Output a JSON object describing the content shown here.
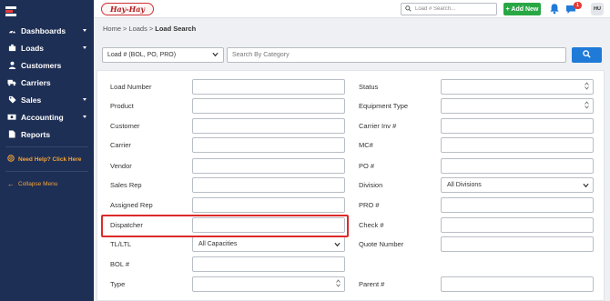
{
  "app": {
    "brand": "Hay-Hay"
  },
  "sidebar": {
    "items": [
      {
        "label": "Dashboards",
        "icon": "dashboard-icon",
        "has_caret": true
      },
      {
        "label": "Loads",
        "icon": "loads-icon",
        "has_caret": true
      },
      {
        "label": "Customers",
        "icon": "customers-icon",
        "has_caret": false
      },
      {
        "label": "Carriers",
        "icon": "truck-icon",
        "has_caret": false
      },
      {
        "label": "Sales",
        "icon": "sales-icon",
        "has_caret": true
      },
      {
        "label": "Accounting",
        "icon": "accounting-icon",
        "has_caret": true
      },
      {
        "label": "Reports",
        "icon": "reports-icon",
        "has_caret": false
      }
    ],
    "help_label": "Need Help? Click Here",
    "collapse_label": "Collapse Menu"
  },
  "topbar": {
    "search_placeholder": "Load # Search...",
    "add_new_label": "+ Add New",
    "message_badge": "1",
    "avatar_initials": "HU"
  },
  "breadcrumb": {
    "home": "Home",
    "sep1": ">",
    "loads": "Loads",
    "sep2": ">",
    "current": "Load Search"
  },
  "search": {
    "category_value": "Load # (BOL, PO, PRO)",
    "input_placeholder": "Search By Category"
  },
  "form": {
    "left": [
      {
        "label": "Load Number",
        "value": "",
        "kind": "text"
      },
      {
        "label": "Product",
        "value": "",
        "kind": "text"
      },
      {
        "label": "Customer",
        "value": "",
        "kind": "text"
      },
      {
        "label": "Carrier",
        "value": "",
        "kind": "text"
      },
      {
        "label": "Vendor",
        "value": "",
        "kind": "text"
      },
      {
        "label": "Sales Rep",
        "value": "",
        "kind": "text"
      },
      {
        "label": "Assigned Rep",
        "value": "",
        "kind": "text"
      },
      {
        "label": "Dispatcher",
        "value": "",
        "kind": "text"
      },
      {
        "label": "TL/LTL",
        "value": "All Capacities",
        "kind": "select"
      },
      {
        "label": "BOL #",
        "value": "",
        "kind": "text"
      },
      {
        "label": "Type",
        "value": "",
        "kind": "multiselect"
      }
    ],
    "right": [
      {
        "label": "Status",
        "value": "",
        "kind": "multiselect"
      },
      {
        "label": "Equipment Type",
        "value": "",
        "kind": "multiselect"
      },
      {
        "label": "Carrier Inv #",
        "value": "",
        "kind": "text"
      },
      {
        "label": "MC#",
        "value": "",
        "kind": "text"
      },
      {
        "label": "PO #",
        "value": "",
        "kind": "text"
      },
      {
        "label": "Division",
        "value": "All Divisions",
        "kind": "select"
      },
      {
        "label": "PRO #",
        "value": "",
        "kind": "text"
      },
      {
        "label": "Check #",
        "value": "",
        "kind": "text"
      },
      {
        "label": "Quote Number",
        "value": "",
        "kind": "text"
      },
      {
        "label": "",
        "value": "",
        "kind": "none"
      },
      {
        "label": "Parent #",
        "value": "",
        "kind": "text"
      }
    ]
  },
  "colors": {
    "sidebar": "#1e2f55",
    "accent_green": "#2aa745",
    "accent_blue": "#1f7ad8",
    "help_orange": "#f2a33a",
    "highlight_red": "#dd2a2a"
  }
}
